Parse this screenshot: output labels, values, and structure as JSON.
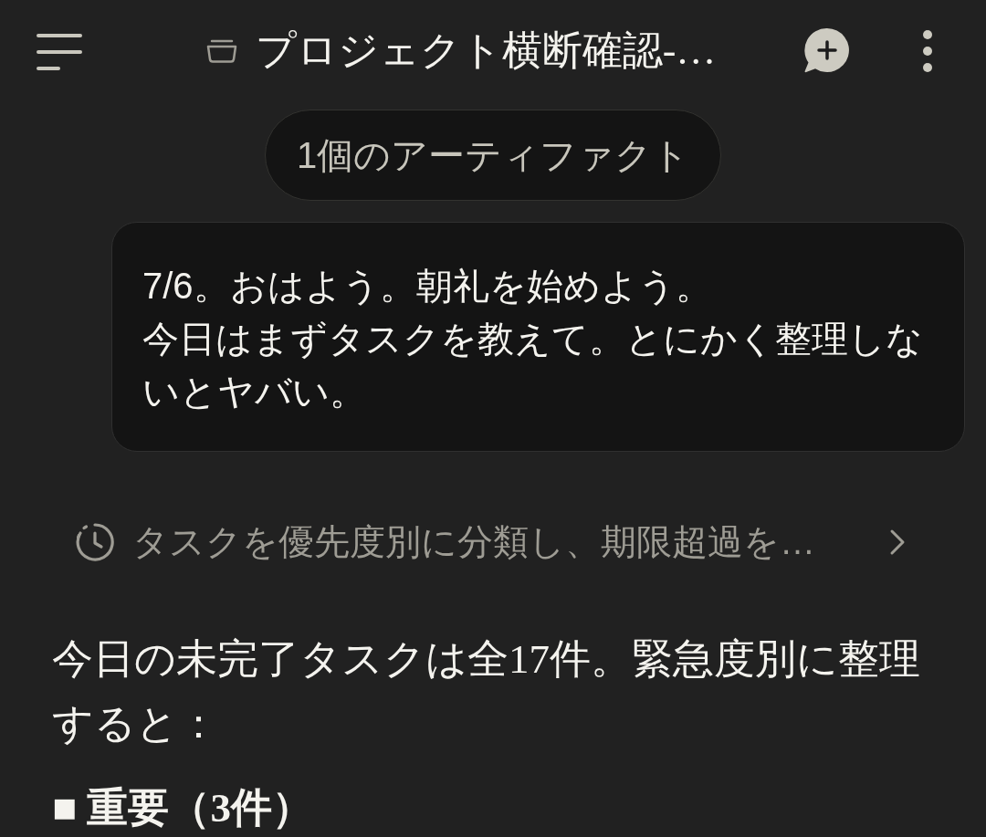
{
  "header": {
    "title": "プロジェクト横断確認-…"
  },
  "artifacts_pill": {
    "label": "1個のアーティファクト"
  },
  "user_message": {
    "paragraphs": [
      "7/6。おはよう。朝礼を始めよう。",
      "今日はまずタスクを教えて。とにかく整理しないとヤバい。"
    ]
  },
  "thinking_summary": {
    "text": "タスクを優先度別に分類し、期限超過を…",
    "expanded": false
  },
  "response": {
    "paragraph": "今日の未完了タスクは全17件。緊急度別に整理すると：",
    "heading": "■ 重要（3件）"
  }
}
